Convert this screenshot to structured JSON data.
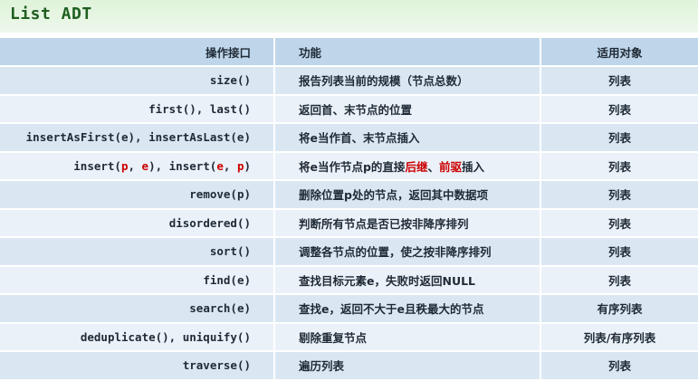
{
  "title": "List ADT",
  "headers": {
    "op": "操作接口",
    "fn": "功能",
    "obj": "适用对象"
  },
  "rows": [
    {
      "op": "size()",
      "fn": "报告列表当前的规模（节点总数）",
      "obj": "列表"
    },
    {
      "op": "first(), last()",
      "fn": "返回首、末节点的位置",
      "obj": "列表"
    },
    {
      "op": "insertAsFirst(e), insertAsLast(e)",
      "fn": "将e当作首、末节点插入",
      "obj": "列表"
    },
    {
      "op_parts": [
        "insert(",
        "p",
        ", ",
        "e",
        "), insert(",
        "e",
        ", ",
        "p",
        ")"
      ],
      "fn_parts": [
        "将e当作节点p的直接",
        "后继",
        "、",
        "前驱",
        "插入"
      ],
      "obj": "列表"
    },
    {
      "op": "remove(p)",
      "fn": "删除位置p处的节点，返回其中数据项",
      "obj": "列表"
    },
    {
      "op": "disordered()",
      "fn": "判断所有节点是否已按非降序排列",
      "obj": "列表"
    },
    {
      "op": "sort()",
      "fn": "调整各节点的位置，使之按非降序排列",
      "obj": "列表"
    },
    {
      "op": "find(e)",
      "fn": "查找目标元素e，失败时返回NULL",
      "obj": "列表"
    },
    {
      "op": "search(e)",
      "fn": "查找e，返回不大于e且秩最大的节点",
      "obj": "有序列表"
    },
    {
      "op": "deduplicate(), uniquify()",
      "fn": "剔除重复节点",
      "obj": "列表/有序列表"
    },
    {
      "op": "traverse()",
      "fn": "遍历列表",
      "obj": "列表"
    }
  ],
  "colors": {
    "title": "#1f5f1f",
    "highlight": "#cc0000",
    "header_bg": "#bfd6ea",
    "row_odd_bg": "#dae7f3",
    "row_even_bg": "#eaf1f8"
  }
}
